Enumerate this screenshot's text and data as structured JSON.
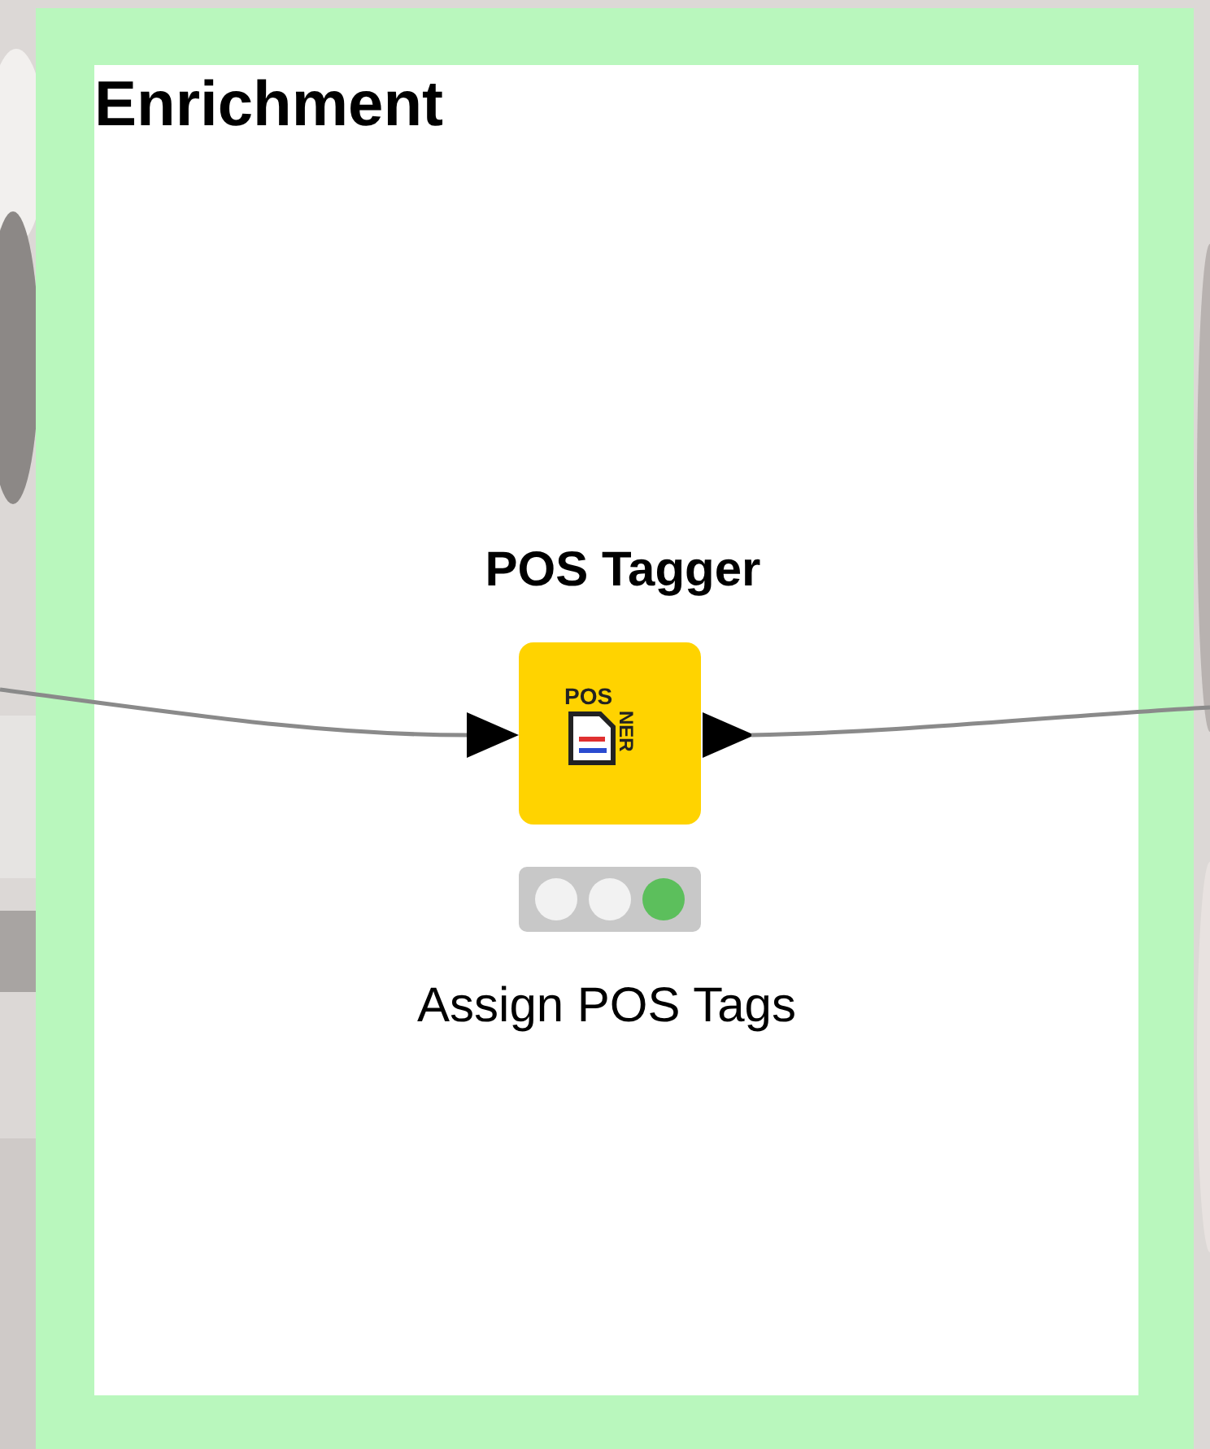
{
  "annotation": {
    "title": "Enrichment"
  },
  "node": {
    "name": "POS Tagger",
    "icon_text": [
      "POS",
      "NER"
    ],
    "description": "Assign POS Tags",
    "status_lights": [
      {
        "lit": false
      },
      {
        "lit": false
      },
      {
        "lit": true,
        "color": "#5cbf5c"
      }
    ]
  }
}
